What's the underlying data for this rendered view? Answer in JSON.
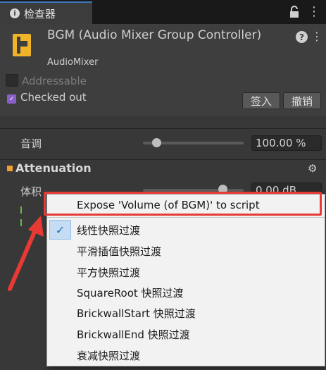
{
  "tab": {
    "title": "检查器"
  },
  "header": {
    "title": "BGM (Audio Mixer Group Controller)",
    "subtitle": "AudioMixer",
    "addressable_label": "Addressable",
    "checked_out_label": "Checked out",
    "checkin_label": "签入",
    "revert_label": "撤销"
  },
  "pitch": {
    "label": "音调",
    "value": "100.00 %"
  },
  "attenuation": {
    "title": "Attenuation",
    "volume_label": "体积",
    "volume_value": "0.00 dB"
  },
  "context_menu": {
    "items": [
      {
        "label": "Expose 'Volume (of BGM)' to script"
      },
      {
        "label": "线性快照过渡",
        "checked": true
      },
      {
        "label": "平滑插值快照过渡"
      },
      {
        "label": "平方快照过渡"
      },
      {
        "label": "SquareRoot 快照过渡"
      },
      {
        "label": "BrickwallStart 快照过渡"
      },
      {
        "label": "BrickwallEnd 快照过渡"
      },
      {
        "label": "衰减快照过渡"
      }
    ]
  },
  "colors": {
    "accent_blue": "#3a79bb",
    "highlight_red": "#e83a34",
    "section_marker": "#f0a032",
    "meter_green": "#6ab83c"
  },
  "icons": [
    "info-icon",
    "lock-icon",
    "more-icon",
    "audio-mixer-group-icon",
    "help-icon",
    "kebab-icon",
    "checked-out-icon",
    "gear-icon",
    "checkmark-icon",
    "red-arrow-annotation"
  ]
}
